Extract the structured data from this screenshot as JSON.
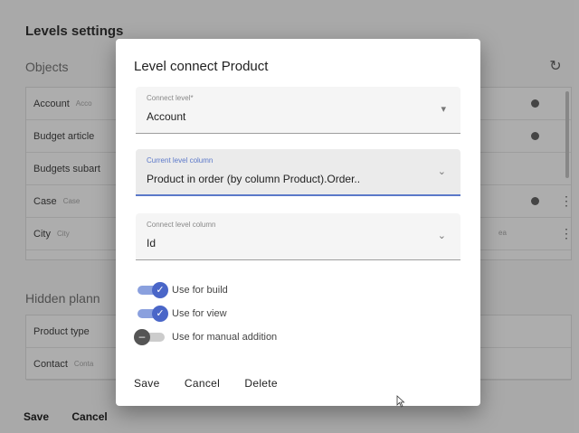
{
  "page": {
    "title": "Levels settings",
    "objects_title": "Objects",
    "hidden_title": "Hidden plann",
    "objects": [
      {
        "name": "Account",
        "sub": "Acco"
      },
      {
        "name": "Budget article",
        "sub": ""
      },
      {
        "name": "Budgets subart",
        "sub": ""
      },
      {
        "name": "Case",
        "sub": "Case"
      },
      {
        "name": "City",
        "sub": "City",
        "side": "ea"
      }
    ],
    "hidden": [
      {
        "name": "Product type",
        "sub": ""
      },
      {
        "name": "Contact",
        "sub": "Conta"
      }
    ],
    "save_label": "Save",
    "cancel_label": "Cancel"
  },
  "dialog": {
    "title": "Level connect Product",
    "fields": [
      {
        "label": "Connect level*",
        "value": "Account"
      },
      {
        "label": "Current level column",
        "value": "Product in order (by column Product).Order.."
      },
      {
        "label": "Connect level column",
        "value": "Id"
      }
    ],
    "toggles": [
      {
        "label": "Use for build",
        "on": true
      },
      {
        "label": "Use for view",
        "on": true
      },
      {
        "label": "Use for manual addition",
        "on": false
      }
    ],
    "actions": {
      "save": "Save",
      "cancel": "Cancel",
      "delete": "Delete"
    }
  },
  "icons": [
    "refresh-icon",
    "more-vert-icon",
    "chevron-down-icon",
    "check-icon",
    "minus-icon",
    "mouse-cursor-icon"
  ],
  "colors": {
    "accent": "#4a66c8",
    "focus": "#5b78c9"
  }
}
